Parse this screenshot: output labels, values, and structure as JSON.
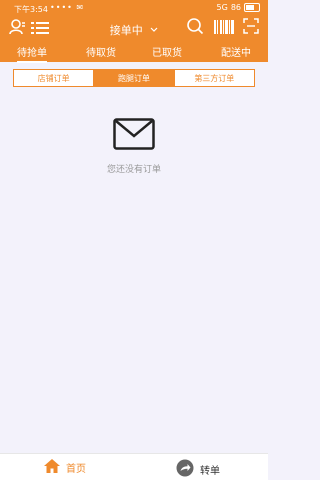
{
  "status_bar": {
    "time": "下午3:54",
    "notification_dots": "•••• ✉",
    "signal": "5G",
    "battery": "86"
  },
  "header": {
    "title": "接单中",
    "user_icon": "user-icon",
    "list_icon": "list-icon",
    "search_icon": "search-icon",
    "barcode_icon": "barcode-icon",
    "scan_icon": "scan-icon"
  },
  "tabs": [
    {
      "label": "待抢单",
      "active": true
    },
    {
      "label": "待取货"
    },
    {
      "label": "已取货"
    },
    {
      "label": "配送中"
    }
  ],
  "segment": [
    {
      "label": "店铺订单"
    },
    {
      "label": "跑腿订单",
      "active": true
    },
    {
      "label": "第三方订单"
    }
  ],
  "empty": {
    "icon": "envelope-icon",
    "text": "您还没有订单"
  },
  "bottom_nav": [
    {
      "label": "首页",
      "icon": "home-icon",
      "active": true
    },
    {
      "label": "转单",
      "icon": "forward-icon"
    }
  ],
  "colors": {
    "accent": "#ef8a2c",
    "background": "#f3f2fb"
  }
}
